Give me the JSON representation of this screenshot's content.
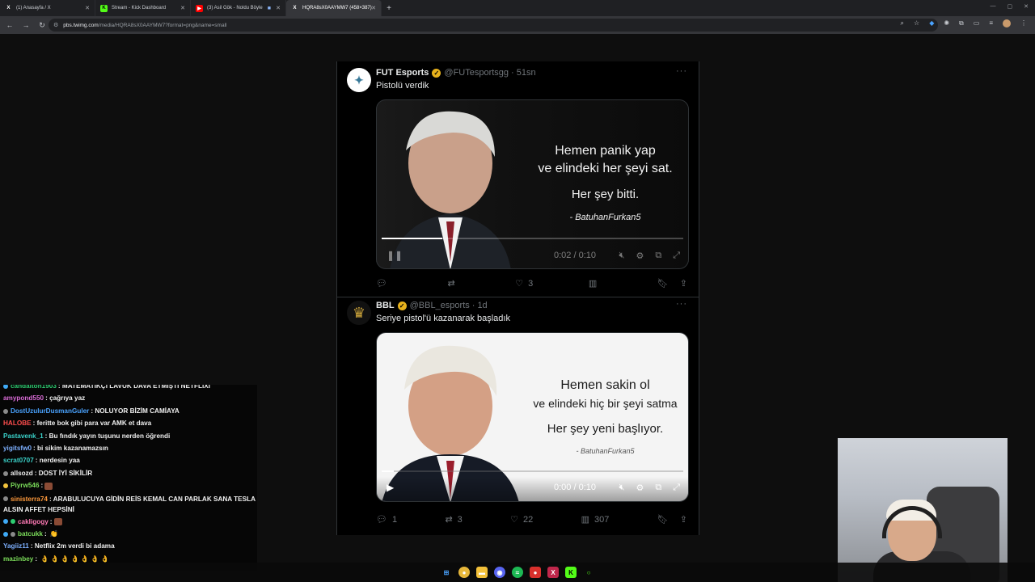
{
  "browser": {
    "tabs": [
      {
        "label": "(1) Anasayfa / X",
        "icon": "x-logo-icon",
        "fav": "X"
      },
      {
        "label": "Stream - Kick Dashboard",
        "icon": "kick-logo-icon",
        "fav": "K"
      },
      {
        "label": "(3) Asil Gök - Noldu Böyle",
        "icon": "youtube-logo-icon",
        "fav": "▶"
      },
      {
        "label": "HQRA8sX0AAYMW7 (458×387)",
        "icon": "x-logo-icon",
        "fav": "X"
      }
    ],
    "active_tab": 3,
    "url_domain": "pbs.twimg.com",
    "url_path": "/media/HQRA8sX0AAYMW7?format=png&name=small"
  },
  "tweets": [
    {
      "name": "FUT Esports",
      "handle": "@FUTesportsgg",
      "time": "51sn",
      "text": "Pistolü verdik",
      "quote_line1": "Hemen panik yap",
      "quote_line2": "ve elindeki her şeyi sat.",
      "quote_line3": "Her şey bitti.",
      "quote_author": "- BatuhanFurkan5",
      "video_time": "0:02 / 0:10",
      "video_progress": 0.2,
      "replies": "",
      "retweets": "",
      "likes": "3",
      "views": ""
    },
    {
      "name": "BBL",
      "handle": "@BBL_esports",
      "time": "1d",
      "text": "Seriye pistol'ü kazanarak başladık",
      "quote_line1": "Hemen sakin ol",
      "quote_line2": "ve elindeki hiç bir şeyi satma",
      "quote_line3": "Her şey yeni başlıyor.",
      "quote_author": "- BatuhanFurkan5",
      "video_time": "0:00 / 0:10",
      "video_progress": 0.04,
      "replies": "1",
      "retweets": "3",
      "likes": "22",
      "views": "307"
    }
  ],
  "chat": [
    {
      "user": "candalton1903",
      "text": ": MATEMATİKÇİ LAVUK DAVA ETMİŞTİ NETFLİXİ",
      "color": "#2ecc71",
      "badge": "#3fa9f5"
    },
    {
      "user": "amypond550",
      "text": ": çağrıya yaz",
      "color": "#d96bd6",
      "badge": ""
    },
    {
      "user": "DostUzulurDusmanGuler",
      "text": ": NOLUYOR BİZİM CAMİAYA",
      "color": "#4aa3ff",
      "badge": "#8a8a8a"
    },
    {
      "user": "HALOBE",
      "text": ": feritte bok gibi para var AMK et dava",
      "color": "#ff4d4d",
      "badge": ""
    },
    {
      "user": "Pastavenk_1",
      "text": ": Bu fındık yayın tuşunu nerden öğrendi",
      "color": "#3ad1c9",
      "badge": ""
    },
    {
      "user": "yigitsfw0",
      "text": ": bi sikim kazanamazsın",
      "color": "#7db0ff",
      "badge": ""
    },
    {
      "user": "scrat0707",
      "text": ": nerdesin yaa",
      "color": "#3ad1c9",
      "badge": ""
    },
    {
      "user": "allsozd",
      "text": ": DOST İYİ SİKİLİR",
      "color": "#f0f0f0",
      "badge": "#8a8a8a"
    },
    {
      "user": "Piyrw546",
      "text": ":",
      "color": "#7bdc5a",
      "badge": "#f2c33c",
      "emote": true
    },
    {
      "user": "sinisterra74",
      "text": ": ARABULUCUYA GİDİN REİS KEMAL CAN PARLAK SANA TESLA ALSIN AFFET HEPSİNİ",
      "color": "#ff9a3c",
      "badge": "#8a8a8a",
      "wrap": true
    },
    {
      "user": "cakligogy",
      "text": ":",
      "color": "#ff7ab6",
      "badge": "#3fa9f5",
      "badge2": "#2ecc71",
      "emote": true
    },
    {
      "user": "batcukk",
      "text": ":",
      "color": "#7bdc5a",
      "badge": "#3fa9f5",
      "badge2": "#8a8a8a",
      "emoji": "👏"
    },
    {
      "user": "Yagiiz11",
      "text": ": Netflix 2m verdi bi adama",
      "color": "#7db0ff",
      "badge": ""
    },
    {
      "user": "mazinbey",
      "text": ":",
      "color": "#7bdc5a",
      "badge": "",
      "emoji": "👌 👌 👌 👌 👌 👌 👌"
    }
  ],
  "colors": {
    "background": "#0e0e0e",
    "tweet_bg": "#000000",
    "muted": "#71767b",
    "verified": "#e8b21c"
  }
}
